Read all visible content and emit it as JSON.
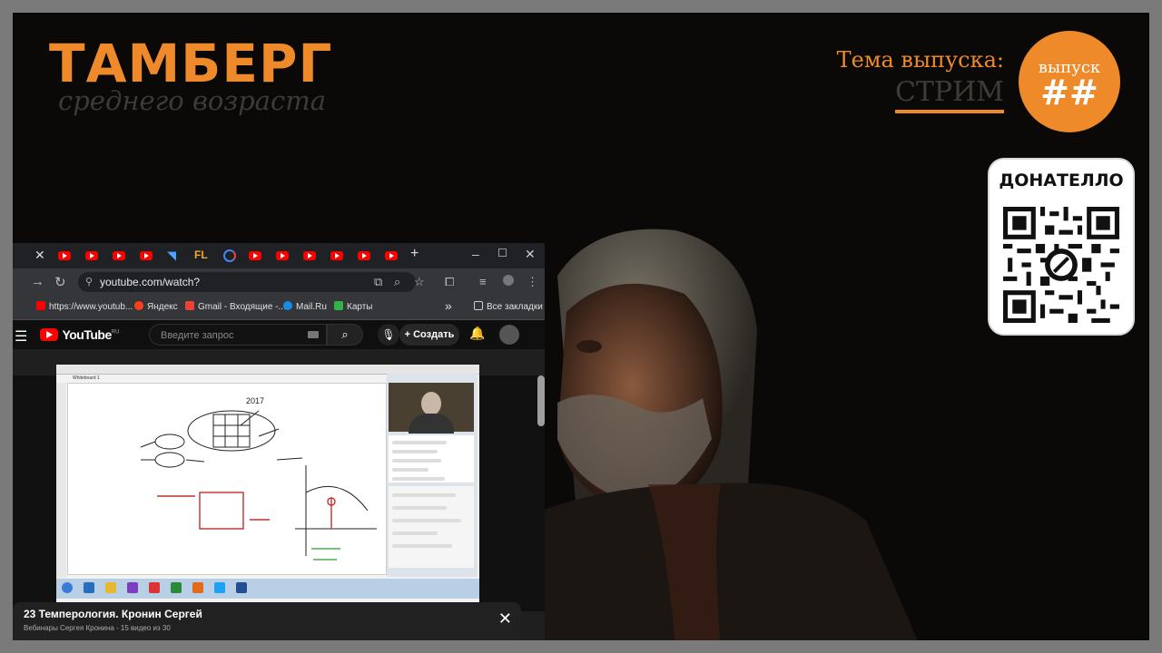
{
  "overlay": {
    "logo_main": "ТАМБЕРГ",
    "logo_sub": "среднего возраста",
    "topic_label": "Тема выпуска:",
    "topic_value": "СТРИМ",
    "badge_label": "выпуск",
    "badge_number": "##",
    "donate_title": "ДОНАТЕЛЛО",
    "accent_color": "#ef8a2a"
  },
  "browser": {
    "url": "youtube.com/watch?v=vqNwALAUm_I&list=PLLESelehXAvvQkOi...",
    "tab_icons": [
      "youtube-icon",
      "youtube-icon",
      "youtube-icon",
      "youtube-icon",
      "bookmark-icon",
      "fl-icon",
      "google-icon",
      "youtube-icon",
      "youtube-icon",
      "youtube-icon",
      "youtube-icon",
      "youtube-icon",
      "youtube-icon"
    ],
    "new_tab": "+",
    "tab_close": "✕",
    "bookmarks": [
      {
        "label": "https://www.youtub...",
        "icon": "youtube-icon"
      },
      {
        "label": "Яндекс",
        "icon": "yandex-icon"
      },
      {
        "label": "Gmail - Входящие -...",
        "icon": "gmail-icon"
      },
      {
        "label": "Mail.Ru",
        "icon": "mailru-icon"
      },
      {
        "label": "Карты",
        "icon": "maps-icon"
      }
    ],
    "bookmarks_more": "»",
    "all_bookmarks": "Все закладки"
  },
  "youtube": {
    "logo_text": "YouTube",
    "region": "RU",
    "search_placeholder": "Введите запрос",
    "create_label": "Создать",
    "video_title": "23 Темперология. Кронин Сергей",
    "playlist_info": "Вебинары Сергея Кронина - 15 видео из 30"
  },
  "inner_screen": {
    "whiteboard_tab": "Whiteboard 1",
    "year_label": "2017"
  }
}
